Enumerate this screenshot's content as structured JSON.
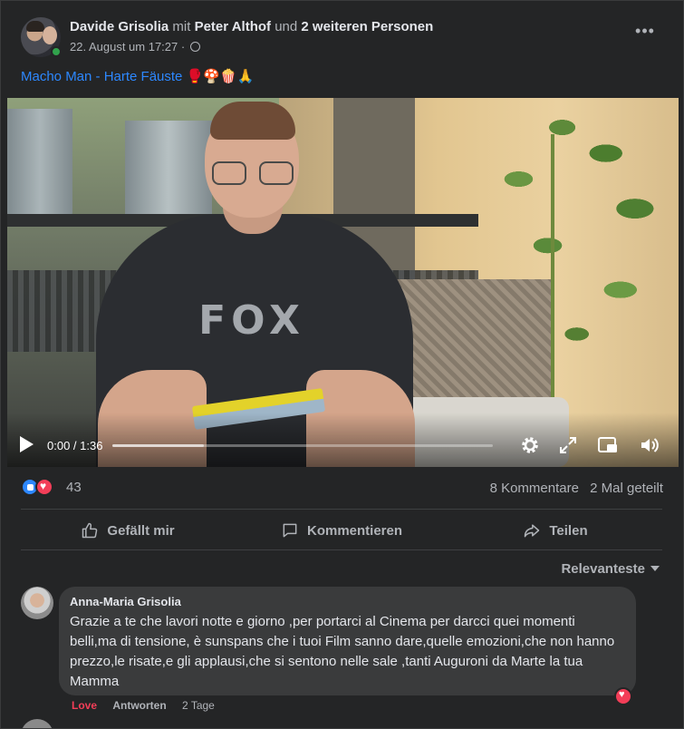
{
  "post": {
    "author": "Davide Grisolia",
    "with_word": "mit",
    "tagged_person": "Peter Althof",
    "and_word": "und",
    "others": "2 weiteren Personen",
    "timestamp": "22. August um 17:27 ·",
    "privacy_icon": "globe-icon",
    "more_label": "•••",
    "caption": "Macho Man - Harte Fäuste 🥊🍄🍿🙏"
  },
  "video": {
    "current_time": "0:00",
    "duration": "1:36",
    "time_display": "0:00 / 1:36",
    "progress": 0.0,
    "shirt_text": "FOX",
    "controls": [
      "play-icon",
      "gear-icon",
      "expand-icon",
      "picture-in-picture-icon",
      "volume-icon"
    ]
  },
  "reactions": {
    "types": [
      "like",
      "love"
    ],
    "count": "43",
    "comments": "8 Kommentare",
    "shares": "2 Mal geteilt"
  },
  "actions": {
    "like": "Gefällt mir",
    "comment": "Kommentieren",
    "share": "Teilen"
  },
  "comments_sort": "Relevanteste",
  "comment": {
    "author": "Anna-Maria Grisolia",
    "text": "Grazie a te che lavori notte e giorno ,per portarci al Cinema per darcci quei momenti belli,ma di tensione, è sunspans che i tuoi Film sanno dare,quelle emozioni,che non hanno prezzo,le risate,e gli applausi,che si sentono nelle sale ,tanti Auguroni da Marte la tua Mamma",
    "reaction_label": "Love",
    "reply_label": "Antworten",
    "age": "2 Tage"
  },
  "colors": {
    "background": "#242526",
    "link_blue": "#2d88ff",
    "love_red": "#f33e58",
    "online_green": "#31a24c"
  }
}
